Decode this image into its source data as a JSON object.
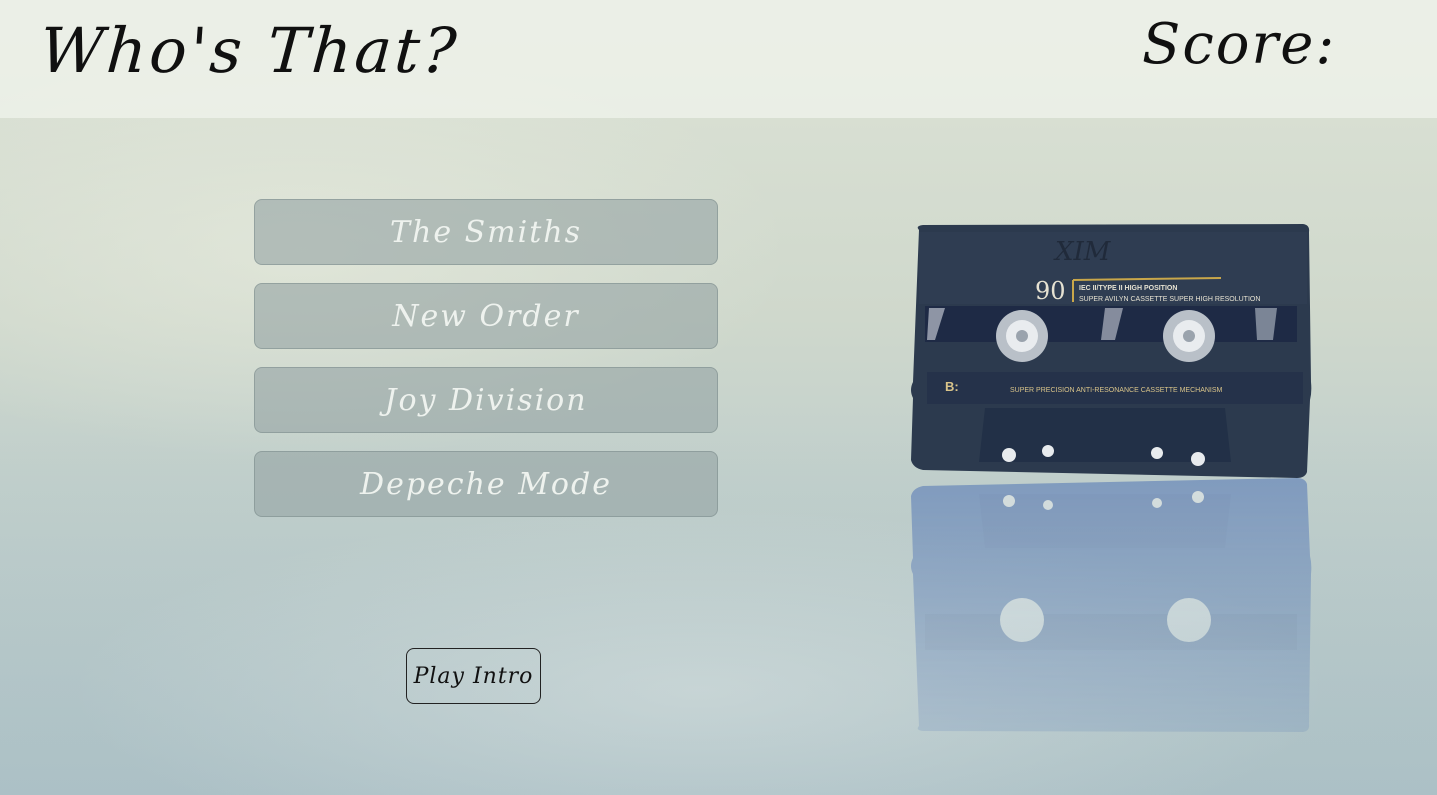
{
  "header": {
    "title": "Who's That?",
    "score_label": "Score:",
    "score_value": ""
  },
  "answers": [
    {
      "label": "The Smiths"
    },
    {
      "label": "New Order"
    },
    {
      "label": "Joy Division"
    },
    {
      "label": "Depeche Mode"
    }
  ],
  "controls": {
    "play_label": "Play Intro"
  },
  "cassette": {
    "handwriting": "XIM",
    "length": "90",
    "spec_line1": "IEC II/TYPE II HIGH POSITION",
    "spec_line2": "SUPER AVILYN CASSETTE SUPER HIGH RESOLUTION",
    "side": "B:",
    "mechanism": "SUPER PRECISION ANTI-RESONANCE CASSETTE MECHANISM"
  },
  "colors": {
    "header_bg": "#eef2ea",
    "answer_bg": "#96a5a5",
    "answer_text": "#eef2ee",
    "cassette_body": "#2c3a4e"
  }
}
